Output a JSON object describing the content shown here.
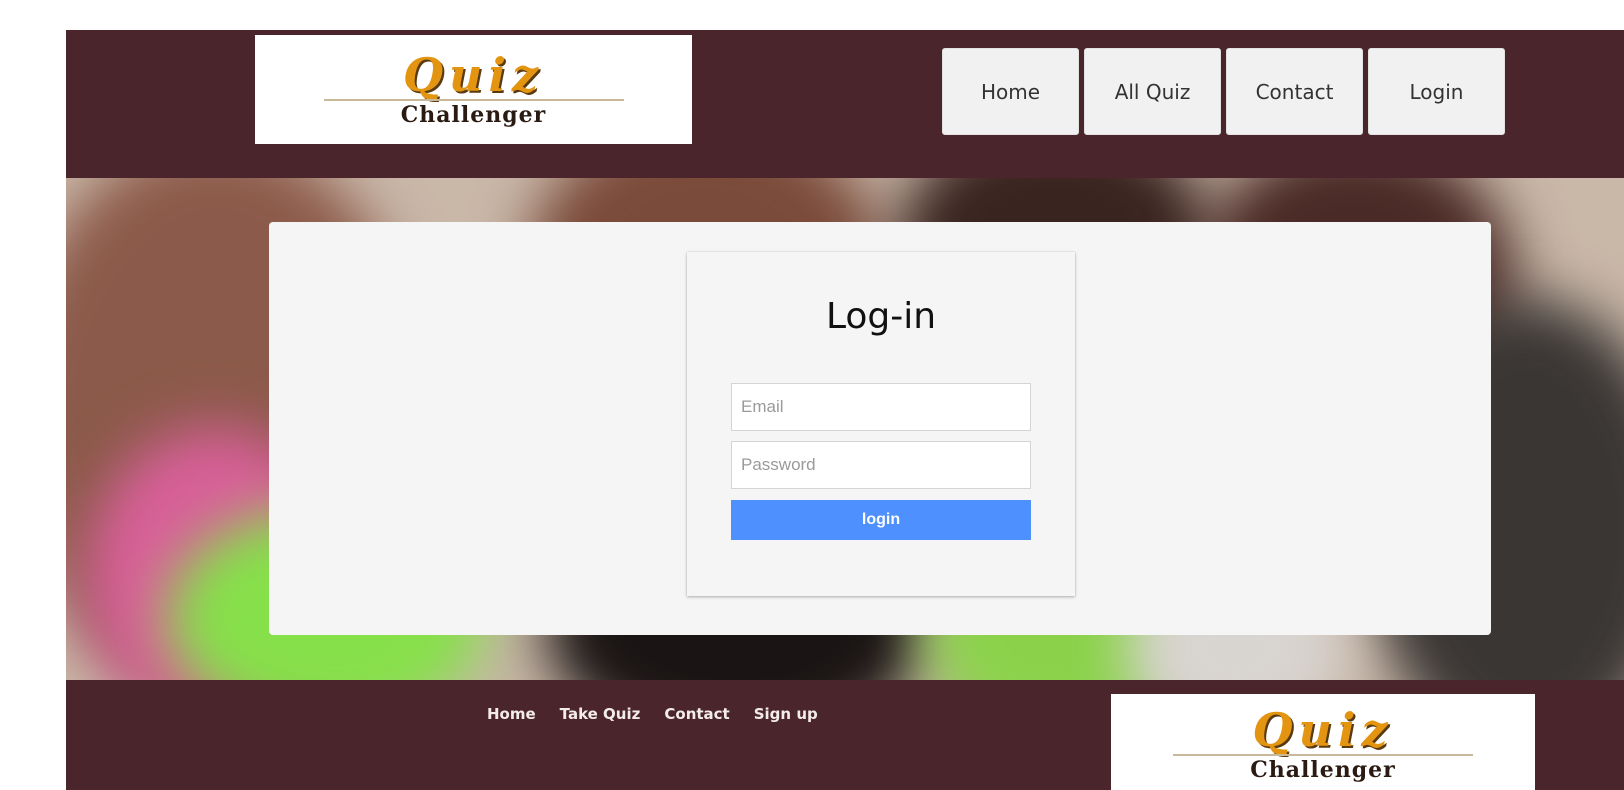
{
  "header": {
    "logo": {
      "title": "Quiz",
      "subtitle": "Challenger"
    },
    "nav": [
      {
        "label": "Home"
      },
      {
        "label": "All Quiz"
      },
      {
        "label": "Contact"
      },
      {
        "label": "Login"
      }
    ]
  },
  "login": {
    "title": "Log-in",
    "email_placeholder": "Email",
    "password_placeholder": "Password",
    "button_label": "login"
  },
  "footer": {
    "links": [
      {
        "label": "Home"
      },
      {
        "label": "Take Quiz"
      },
      {
        "label": "Contact"
      },
      {
        "label": "Sign up"
      }
    ],
    "logo": {
      "title": "Quiz",
      "subtitle": "Challenger"
    }
  },
  "colors": {
    "brand_bar": "#4a252b",
    "logo_accent": "#e39411",
    "button": "#4d90fe"
  }
}
